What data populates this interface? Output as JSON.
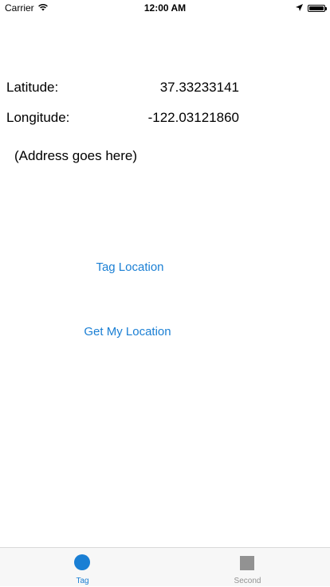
{
  "status_bar": {
    "carrier": "Carrier",
    "time": "12:00 AM",
    "battery_level": 1.0
  },
  "location": {
    "latitude_label": "Latitude:",
    "latitude_value": "37.33233141",
    "longitude_label": "Longitude:",
    "longitude_value": "-122.03121860",
    "address": "(Address goes here)"
  },
  "buttons": {
    "tag_location": "Tag Location",
    "get_my_location": "Get My Location"
  },
  "tab_bar": {
    "items": [
      {
        "label": "Tag",
        "selected": true,
        "icon": "circle-icon"
      },
      {
        "label": "Second",
        "selected": false,
        "icon": "square-icon"
      }
    ]
  },
  "colors": {
    "accent": "#1a7fd4",
    "inactive": "#929292",
    "tab_bar_bg": "#f7f7f7"
  }
}
